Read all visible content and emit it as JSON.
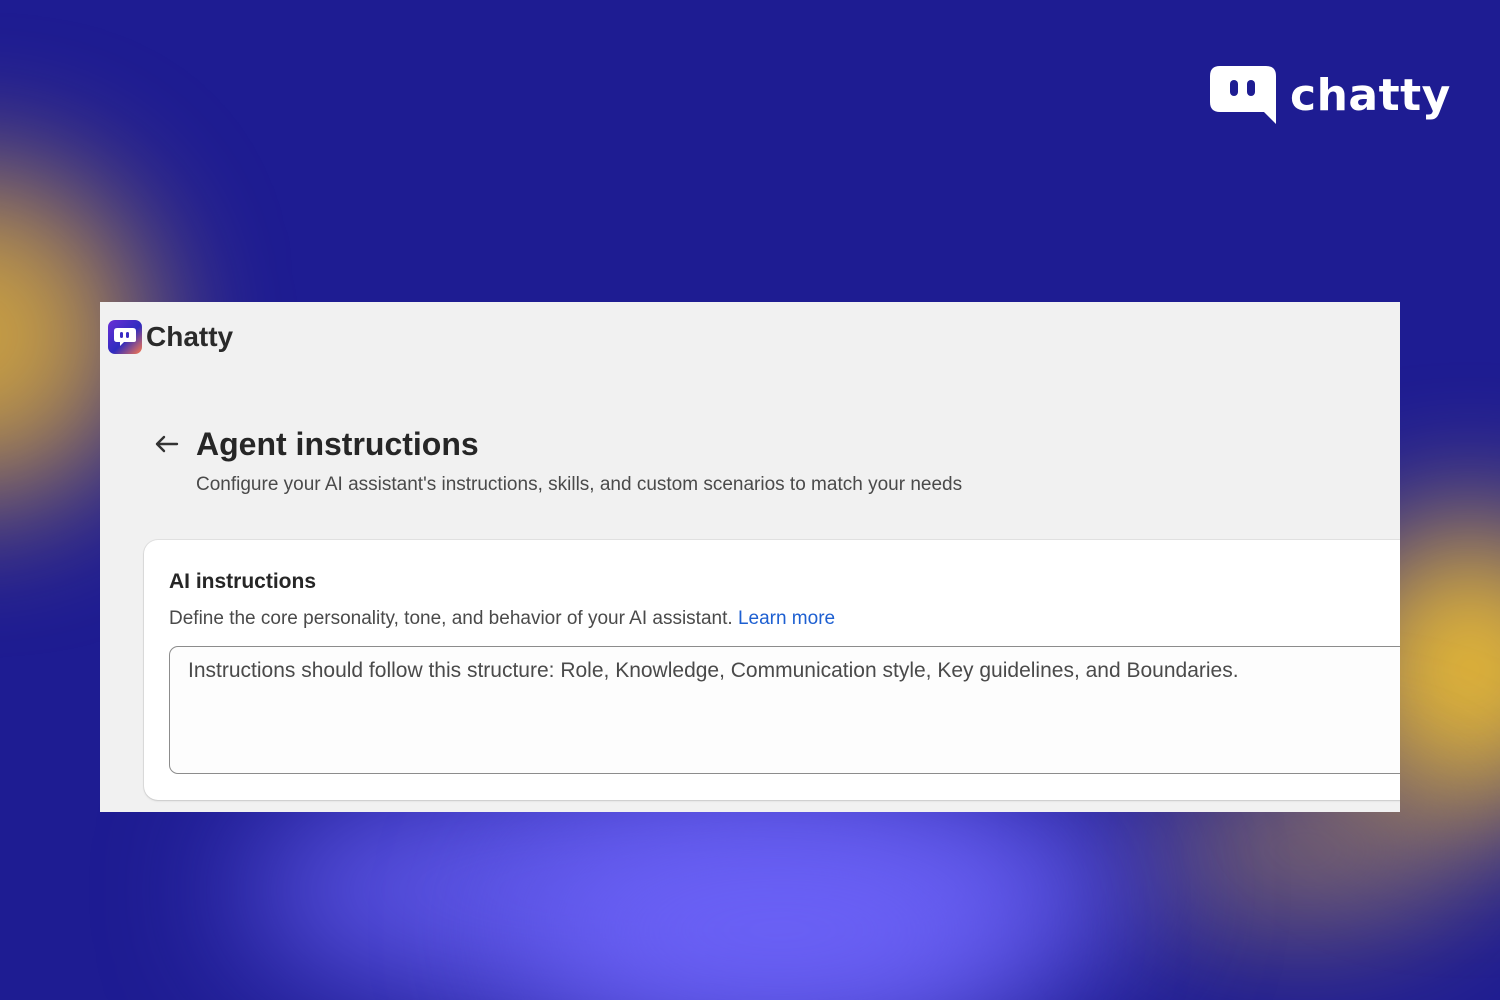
{
  "brand": {
    "name": "chatty",
    "icon": "chat-bubble-icon"
  },
  "app": {
    "name": "Chatty",
    "icon": "chatty-app-icon"
  },
  "page": {
    "title": "Agent instructions",
    "subtitle": "Configure your AI assistant's instructions, skills, and custom scenarios to match your needs",
    "back_icon": "arrow-left-icon"
  },
  "ai_instructions": {
    "title": "AI instructions",
    "description": "Define the core personality, tone, and behavior of your AI assistant.",
    "learn_more": "Learn more",
    "value": "Instructions should follow this structure: Role, Knowledge, Communication style, Key guidelines, and Boundaries."
  },
  "colors": {
    "background": "#1e1c92",
    "link": "#1d5fd1",
    "glow_yellow": "#f4c42e",
    "glow_purple": "#645cf0"
  }
}
